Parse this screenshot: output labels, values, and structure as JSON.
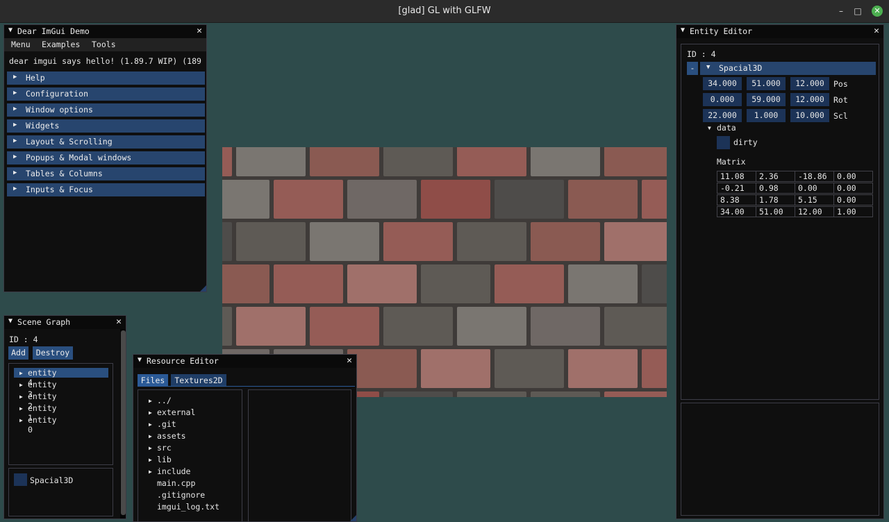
{
  "window": {
    "title": "[glad] GL with GLFW",
    "min_icon": "minimize-icon",
    "max_icon": "maximize-icon",
    "close_icon": "close-icon"
  },
  "colors": {
    "background": "#2e4b4b",
    "header": "#27456e",
    "button": "#2a4f7f",
    "window_bg": "#0f0f0f",
    "close": "#4caf50"
  },
  "demo": {
    "title": "Dear ImGui Demo",
    "menu": [
      "Menu",
      "Examples",
      "Tools"
    ],
    "hello": "dear imgui says hello! (1.89.7 WIP) (189",
    "sections": [
      "Help",
      "Configuration",
      "Window options",
      "Widgets",
      "Layout & Scrolling",
      "Popups & Modal windows",
      "Tables & Columns",
      "Inputs & Focus"
    ]
  },
  "scene": {
    "title": "Scene Graph",
    "id_label": "ID : 4",
    "add": "Add",
    "destroy": "Destroy",
    "entities": [
      "entity 4",
      "entity 3",
      "entity 2",
      "entity 1",
      "entity 0"
    ],
    "component": "Spacial3D"
  },
  "resource": {
    "title": "Resource Editor",
    "tabs": [
      "Files",
      "Textures2D"
    ],
    "files": [
      {
        "name": "../",
        "dir": true
      },
      {
        "name": "external",
        "dir": true
      },
      {
        "name": ".git",
        "dir": true
      },
      {
        "name": "assets",
        "dir": true
      },
      {
        "name": "src",
        "dir": true
      },
      {
        "name": "lib",
        "dir": true
      },
      {
        "name": "include",
        "dir": true
      },
      {
        "name": "main.cpp",
        "dir": false
      },
      {
        "name": ".gitignore",
        "dir": false
      },
      {
        "name": "imgui_log.txt",
        "dir": false
      }
    ]
  },
  "entity": {
    "title": "Entity Editor",
    "id_label": "ID : 4",
    "collapse": "-",
    "component": "Spacial3D",
    "rows": [
      {
        "label": "Pos",
        "values": [
          "34.000",
          "51.000",
          "12.000"
        ]
      },
      {
        "label": "Rot",
        "values": [
          "0.000",
          "59.000",
          "12.000"
        ]
      },
      {
        "label": "Scl",
        "values": [
          "22.000",
          "1.000",
          "10.000"
        ]
      }
    ],
    "data_label": "data",
    "dirty": "dirty",
    "matrix_label": "Matrix",
    "matrix": [
      [
        "11.08",
        "2.36",
        "-18.86",
        "0.00"
      ],
      [
        "-0.21",
        "0.98",
        "0.00",
        "0.00"
      ],
      [
        "8.38",
        "1.78",
        "5.15",
        "0.00"
      ],
      [
        "34.00",
        "51.00",
        "12.00",
        "1.00"
      ]
    ]
  }
}
